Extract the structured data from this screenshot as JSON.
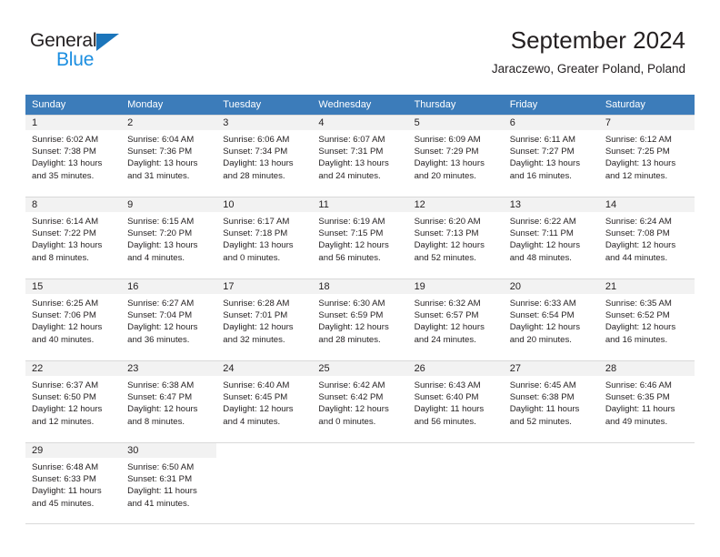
{
  "brand": {
    "name_top": "General",
    "name_bottom": "Blue",
    "triangle_color": "#1b75bb",
    "text_color": "#231f20",
    "blue_color": "#1b8ee0"
  },
  "header": {
    "title": "September 2024",
    "subtitle": "Jaraczewo, Greater Poland, Poland"
  },
  "theme": {
    "header_bg": "#3c7cba",
    "header_text": "#ffffff",
    "daynum_bg": "#f2f2f2",
    "cell_bg": "#ffffff",
    "border": "#d9d9d9"
  },
  "weekdays": [
    "Sunday",
    "Monday",
    "Tuesday",
    "Wednesday",
    "Thursday",
    "Friday",
    "Saturday"
  ],
  "weeks": [
    [
      {
        "day": "1",
        "sunrise": "Sunrise: 6:02 AM",
        "sunset": "Sunset: 7:38 PM",
        "daylight1": "Daylight: 13 hours",
        "daylight2": "and 35 minutes."
      },
      {
        "day": "2",
        "sunrise": "Sunrise: 6:04 AM",
        "sunset": "Sunset: 7:36 PM",
        "daylight1": "Daylight: 13 hours",
        "daylight2": "and 31 minutes."
      },
      {
        "day": "3",
        "sunrise": "Sunrise: 6:06 AM",
        "sunset": "Sunset: 7:34 PM",
        "daylight1": "Daylight: 13 hours",
        "daylight2": "and 28 minutes."
      },
      {
        "day": "4",
        "sunrise": "Sunrise: 6:07 AM",
        "sunset": "Sunset: 7:31 PM",
        "daylight1": "Daylight: 13 hours",
        "daylight2": "and 24 minutes."
      },
      {
        "day": "5",
        "sunrise": "Sunrise: 6:09 AM",
        "sunset": "Sunset: 7:29 PM",
        "daylight1": "Daylight: 13 hours",
        "daylight2": "and 20 minutes."
      },
      {
        "day": "6",
        "sunrise": "Sunrise: 6:11 AM",
        "sunset": "Sunset: 7:27 PM",
        "daylight1": "Daylight: 13 hours",
        "daylight2": "and 16 minutes."
      },
      {
        "day": "7",
        "sunrise": "Sunrise: 6:12 AM",
        "sunset": "Sunset: 7:25 PM",
        "daylight1": "Daylight: 13 hours",
        "daylight2": "and 12 minutes."
      }
    ],
    [
      {
        "day": "8",
        "sunrise": "Sunrise: 6:14 AM",
        "sunset": "Sunset: 7:22 PM",
        "daylight1": "Daylight: 13 hours",
        "daylight2": "and 8 minutes."
      },
      {
        "day": "9",
        "sunrise": "Sunrise: 6:15 AM",
        "sunset": "Sunset: 7:20 PM",
        "daylight1": "Daylight: 13 hours",
        "daylight2": "and 4 minutes."
      },
      {
        "day": "10",
        "sunrise": "Sunrise: 6:17 AM",
        "sunset": "Sunset: 7:18 PM",
        "daylight1": "Daylight: 13 hours",
        "daylight2": "and 0 minutes."
      },
      {
        "day": "11",
        "sunrise": "Sunrise: 6:19 AM",
        "sunset": "Sunset: 7:15 PM",
        "daylight1": "Daylight: 12 hours",
        "daylight2": "and 56 minutes."
      },
      {
        "day": "12",
        "sunrise": "Sunrise: 6:20 AM",
        "sunset": "Sunset: 7:13 PM",
        "daylight1": "Daylight: 12 hours",
        "daylight2": "and 52 minutes."
      },
      {
        "day": "13",
        "sunrise": "Sunrise: 6:22 AM",
        "sunset": "Sunset: 7:11 PM",
        "daylight1": "Daylight: 12 hours",
        "daylight2": "and 48 minutes."
      },
      {
        "day": "14",
        "sunrise": "Sunrise: 6:24 AM",
        "sunset": "Sunset: 7:08 PM",
        "daylight1": "Daylight: 12 hours",
        "daylight2": "and 44 minutes."
      }
    ],
    [
      {
        "day": "15",
        "sunrise": "Sunrise: 6:25 AM",
        "sunset": "Sunset: 7:06 PM",
        "daylight1": "Daylight: 12 hours",
        "daylight2": "and 40 minutes."
      },
      {
        "day": "16",
        "sunrise": "Sunrise: 6:27 AM",
        "sunset": "Sunset: 7:04 PM",
        "daylight1": "Daylight: 12 hours",
        "daylight2": "and 36 minutes."
      },
      {
        "day": "17",
        "sunrise": "Sunrise: 6:28 AM",
        "sunset": "Sunset: 7:01 PM",
        "daylight1": "Daylight: 12 hours",
        "daylight2": "and 32 minutes."
      },
      {
        "day": "18",
        "sunrise": "Sunrise: 6:30 AM",
        "sunset": "Sunset: 6:59 PM",
        "daylight1": "Daylight: 12 hours",
        "daylight2": "and 28 minutes."
      },
      {
        "day": "19",
        "sunrise": "Sunrise: 6:32 AM",
        "sunset": "Sunset: 6:57 PM",
        "daylight1": "Daylight: 12 hours",
        "daylight2": "and 24 minutes."
      },
      {
        "day": "20",
        "sunrise": "Sunrise: 6:33 AM",
        "sunset": "Sunset: 6:54 PM",
        "daylight1": "Daylight: 12 hours",
        "daylight2": "and 20 minutes."
      },
      {
        "day": "21",
        "sunrise": "Sunrise: 6:35 AM",
        "sunset": "Sunset: 6:52 PM",
        "daylight1": "Daylight: 12 hours",
        "daylight2": "and 16 minutes."
      }
    ],
    [
      {
        "day": "22",
        "sunrise": "Sunrise: 6:37 AM",
        "sunset": "Sunset: 6:50 PM",
        "daylight1": "Daylight: 12 hours",
        "daylight2": "and 12 minutes."
      },
      {
        "day": "23",
        "sunrise": "Sunrise: 6:38 AM",
        "sunset": "Sunset: 6:47 PM",
        "daylight1": "Daylight: 12 hours",
        "daylight2": "and 8 minutes."
      },
      {
        "day": "24",
        "sunrise": "Sunrise: 6:40 AM",
        "sunset": "Sunset: 6:45 PM",
        "daylight1": "Daylight: 12 hours",
        "daylight2": "and 4 minutes."
      },
      {
        "day": "25",
        "sunrise": "Sunrise: 6:42 AM",
        "sunset": "Sunset: 6:42 PM",
        "daylight1": "Daylight: 12 hours",
        "daylight2": "and 0 minutes."
      },
      {
        "day": "26",
        "sunrise": "Sunrise: 6:43 AM",
        "sunset": "Sunset: 6:40 PM",
        "daylight1": "Daylight: 11 hours",
        "daylight2": "and 56 minutes."
      },
      {
        "day": "27",
        "sunrise": "Sunrise: 6:45 AM",
        "sunset": "Sunset: 6:38 PM",
        "daylight1": "Daylight: 11 hours",
        "daylight2": "and 52 minutes."
      },
      {
        "day": "28",
        "sunrise": "Sunrise: 6:46 AM",
        "sunset": "Sunset: 6:35 PM",
        "daylight1": "Daylight: 11 hours",
        "daylight2": "and 49 minutes."
      }
    ],
    [
      {
        "day": "29",
        "sunrise": "Sunrise: 6:48 AM",
        "sunset": "Sunset: 6:33 PM",
        "daylight1": "Daylight: 11 hours",
        "daylight2": "and 45 minutes."
      },
      {
        "day": "30",
        "sunrise": "Sunrise: 6:50 AM",
        "sunset": "Sunset: 6:31 PM",
        "daylight1": "Daylight: 11 hours",
        "daylight2": "and 41 minutes."
      },
      {
        "day": "",
        "sunrise": "",
        "sunset": "",
        "daylight1": "",
        "daylight2": ""
      },
      {
        "day": "",
        "sunrise": "",
        "sunset": "",
        "daylight1": "",
        "daylight2": ""
      },
      {
        "day": "",
        "sunrise": "",
        "sunset": "",
        "daylight1": "",
        "daylight2": ""
      },
      {
        "day": "",
        "sunrise": "",
        "sunset": "",
        "daylight1": "",
        "daylight2": ""
      },
      {
        "day": "",
        "sunrise": "",
        "sunset": "",
        "daylight1": "",
        "daylight2": ""
      }
    ]
  ]
}
